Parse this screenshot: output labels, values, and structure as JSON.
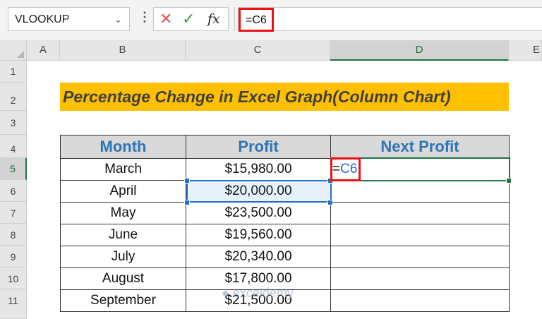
{
  "formula_bar": {
    "name_box": "VLOOKUP",
    "formula": "=C6",
    "fx_label": "fx"
  },
  "columns": [
    "A",
    "B",
    "C",
    "D",
    "E"
  ],
  "rows": [
    "1",
    "2",
    "3",
    "4",
    "5",
    "6",
    "7",
    "8",
    "9",
    "10",
    "11"
  ],
  "title": "Percentage Change in Excel Graph(Column Chart)",
  "table": {
    "headers": [
      "Month",
      "Profit",
      "Next Profit"
    ],
    "rows": [
      {
        "month": "March",
        "profit": "$15,980.00"
      },
      {
        "month": "April",
        "profit": "$20,000.00"
      },
      {
        "month": "May",
        "profit": "$23,500.00"
      },
      {
        "month": "June",
        "profit": "$19,560.00"
      },
      {
        "month": "July",
        "profit": "$20,340.00"
      },
      {
        "month": "August",
        "profit": "$17,800.00"
      },
      {
        "month": "September",
        "profit": "$21,500.00"
      }
    ]
  },
  "editing_cell": {
    "eq": "=",
    "ref": "C6"
  },
  "watermark": "exceldemy",
  "colors": {
    "header_text": "#2e75b6",
    "title_fill": "#ffc000",
    "highlight_border": "#ee1111",
    "selection": "#1f6cc9",
    "active_cell": "#217346"
  }
}
